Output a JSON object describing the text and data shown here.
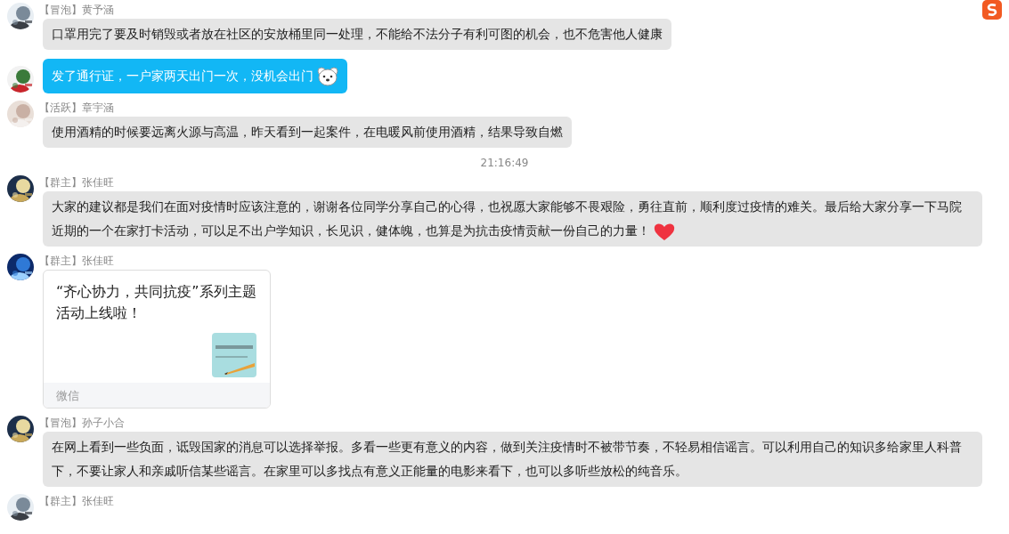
{
  "messages": [
    {
      "kind": "text",
      "title": "【冒泡】",
      "name": "黄予涵",
      "text": "口罩用完了要及时销毁或者放在社区的安放桶里同一处理，不能给不法分子有利可图的机会，也不危害他人健康",
      "highlighted": false
    },
    {
      "kind": "text",
      "text": "发了通行证，一户家两天出门一次，没机会出门",
      "highlighted": true,
      "sticker": {
        "kind": "bear"
      }
    },
    {
      "kind": "text",
      "title": "【活跃】",
      "name": "章宇涵",
      "text": "使用酒精的时候要远离火源与高温，昨天看到一起案件，在电暖风前使用酒精，结果导致自燃",
      "highlighted": false
    },
    {
      "kind": "time",
      "text": "21:16:49"
    },
    {
      "kind": "text",
      "title": "【群主】",
      "name": "张佳旺",
      "text": "大家的建议都是我们在面对疫情时应该注意的，谢谢各位同学分享自己的心得，也祝愿大家能够不畏艰险，勇往直前，顺利度过疫情的难关。最后给大家分享一下马院近期的一个在家打卡活动，可以足不出户学知识，长见识，健体魄，也算是为抗击疫情贡献一份自己的力量！",
      "highlighted": false,
      "sticker": {
        "kind": "heart"
      }
    },
    {
      "kind": "card",
      "title": "【群主】",
      "name": "张佳旺",
      "text": "“齐心协力，共同抗疫”系列主题活动上线啦！",
      "source": "微信"
    },
    {
      "kind": "text",
      "title": "【冒泡】",
      "name": "孙子小合",
      "text": "在网上看到一些负面，诋毁国家的消息可以选择举报。多看一些更有意义的内容，做到关注疫情时不被带节奏，不轻易相信谣言。可以利用自己的知识多给家里人科普下，不要让家人和亲戚听信某些谣言。在家里可以多找点有意义正能量的电影来看下，也可以多听些放松的纯音乐。",
      "highlighted": false
    },
    {
      "kind": "header",
      "title": "【群主】",
      "name": "张佳旺"
    }
  ]
}
